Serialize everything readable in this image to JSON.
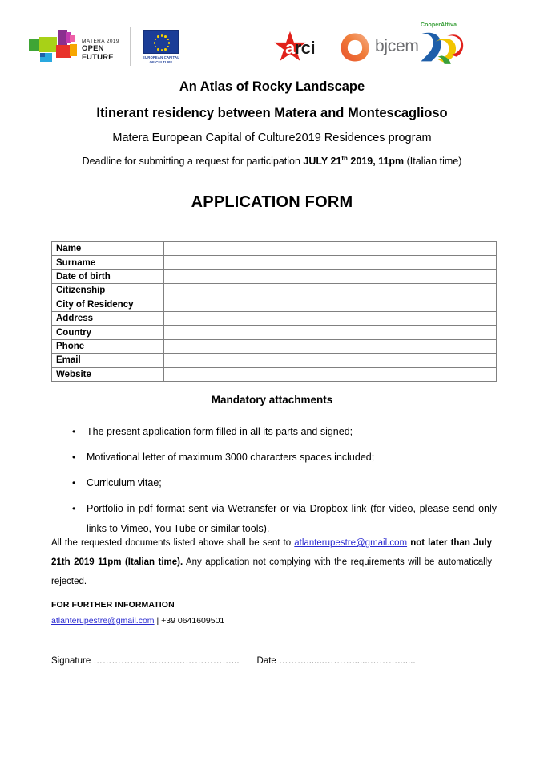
{
  "header": {
    "matera_logo": {
      "icon": "matera-2019-logo",
      "line1": "MATERA 2019",
      "line2": "OPEN FUTURE",
      "colors": [
        "#3fa535",
        "#a8d117",
        "#8a2f8f",
        "#c23bb0",
        "#ee5fa7",
        "#e8322a",
        "#f7a600",
        "#29a8df",
        "#1f5fa9"
      ]
    },
    "eu_logo": {
      "icon": "european-capital-of-culture-logo",
      "caption_line1": "EUROPEAN CAPITAL",
      "caption_line2": "OF CULTURE",
      "flag_color": "#1b3d97",
      "star_color": "#f5d000"
    },
    "arci_logo": {
      "icon": "arci-star-logo",
      "text_a": "a",
      "text_rc": "rci",
      "color": "#e1211b"
    },
    "bjcem_logo": {
      "icon": "bjcem-ring-logo",
      "text": "bjcem",
      "ring_color": "#ef7d38",
      "text_color": "#6d6e71"
    },
    "cooper_logo": {
      "icon": "cooperattiva-logo",
      "text": "CooperAttiva",
      "text_color": "#3aa03a",
      "figure_colors": [
        "#1f5fa9",
        "#f2c500",
        "#e1211b",
        "#3aa03a"
      ]
    }
  },
  "title": {
    "line1": "An Atlas of Rocky Landscape",
    "line2": "Itinerant residency between Matera and Montescaglioso",
    "subtitle": "Matera European Capital of Culture2019 Residences program",
    "deadline_prefix": "Deadline for submitting a request for participation ",
    "deadline_bold_1": "JULY 21",
    "deadline_sup": "th",
    "deadline_bold_2": " 2019, 11pm",
    "deadline_suffix": " (Italian time)"
  },
  "form": {
    "heading": "APPLICATION FORM",
    "rows": [
      {
        "label": "Name",
        "value": ""
      },
      {
        "label": "Surname",
        "value": ""
      },
      {
        "label": "Date of birth",
        "value": ""
      },
      {
        "label": "Citizenship",
        "value": ""
      },
      {
        "label": "City of Residency",
        "value": ""
      },
      {
        "label": "Address",
        "value": ""
      },
      {
        "label": "Country",
        "value": ""
      },
      {
        "label": "Phone",
        "value": ""
      },
      {
        "label": "Email",
        "value": ""
      },
      {
        "label": "Website",
        "value": ""
      }
    ]
  },
  "attachments": {
    "heading": "Mandatory attachments",
    "bullet": "•",
    "items": [
      "The present application form filled in all its parts and signed;",
      "Motivational letter of maximum 3000 characters spaces included;",
      "Curriculum vitae;",
      "Portfolio in pdf format sent via Wetransfer or via Dropbox link (for video, please send only links to Vimeo, You Tube or similar tools)."
    ]
  },
  "send_paragraph": {
    "part1": "All the requested documents listed above shall be sent to ",
    "email": "atlanterupestre@gmail.com",
    "part2_bold": " not later than July 21th 2019 11pm (Italian time).",
    "part3": " Any application not complying with the requirements will be automatically rejected."
  },
  "further_information": {
    "heading": "FOR FURTHER INFORMATION",
    "email": "atlanterupestre@gmail.com",
    "separator": " | ",
    "phone": "+39 0641609501"
  },
  "signature": {
    "signature_label": "Signature",
    "signature_dots": " ………………………………………...",
    "date_label": "Date",
    "date_dots": " ……….......……….......……….......",
    "link_color": "#2a2ad0"
  }
}
